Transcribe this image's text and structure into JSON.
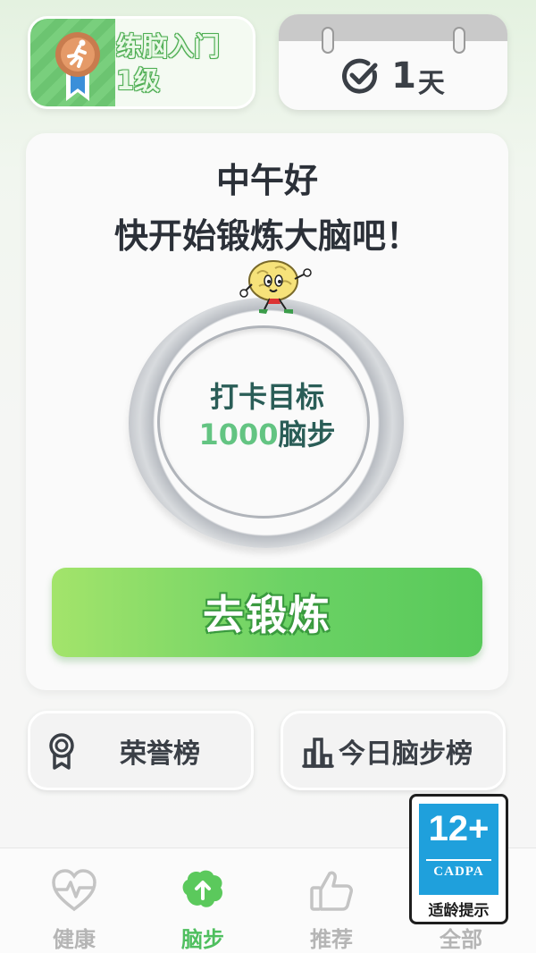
{
  "level_card": {
    "line1": "练脑入门",
    "line2": "1级"
  },
  "checkin": {
    "days": "1",
    "unit": "天"
  },
  "main": {
    "greeting": "中午好",
    "subtitle": "快开始锻炼大脑吧！",
    "goal_label": "打卡目标",
    "goal_value": "1000",
    "goal_unit": "脑步",
    "action_button": "去锻炼"
  },
  "ranks": {
    "honor": "荣誉榜",
    "daily": "今日脑步榜"
  },
  "age_badge": {
    "age": "12+",
    "org": "CADPA",
    "tip": "适龄提示"
  },
  "tabs": [
    {
      "label": "健康",
      "icon": "heart-pulse-icon",
      "active": false
    },
    {
      "label": "脑步",
      "icon": "brain-icon",
      "active": true
    },
    {
      "label": "推荐",
      "icon": "thumbs-up-icon",
      "active": false
    },
    {
      "label": "全部",
      "icon": "grid-icon",
      "active": false
    }
  ],
  "colors": {
    "accent_green": "#5bc95c",
    "goal_number": "#63c482",
    "cadpa_blue": "#1fa0dc"
  }
}
